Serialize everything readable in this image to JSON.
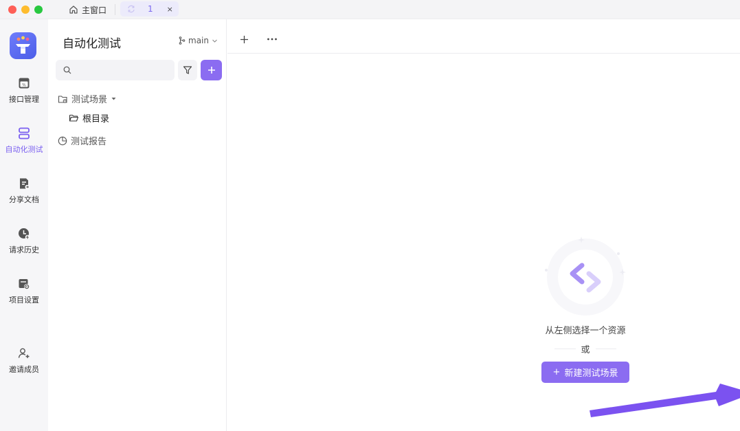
{
  "titlebar": {
    "tabs": [
      {
        "label": "主窗口",
        "icon": "home-icon"
      },
      {
        "label": "1",
        "icon": "sync-icon",
        "close": "×"
      }
    ]
  },
  "rail": {
    "items": [
      {
        "label": "接口管理",
        "icon": "api-icon",
        "active": false
      },
      {
        "label": "自动化测试",
        "icon": "automation-icon",
        "active": true
      },
      {
        "label": "分享文档",
        "icon": "share-doc-icon",
        "active": false
      },
      {
        "label": "请求历史",
        "icon": "history-icon",
        "active": false
      },
      {
        "label": "项目设置",
        "icon": "settings-icon",
        "active": false
      },
      {
        "label": "邀请成员",
        "icon": "invite-user-icon",
        "active": false
      }
    ]
  },
  "panel": {
    "title": "自动化测试",
    "branch": "main",
    "search": {
      "value": "",
      "placeholder": ""
    },
    "tree": {
      "scenes_label": "测试场景",
      "root_label": "根目录",
      "reports_label": "测试报告"
    }
  },
  "main": {
    "empty_text": "从左侧选择一个资源",
    "or_text": "或",
    "new_button": "新建测试场景",
    "new_button_prefix": "+"
  },
  "colors": {
    "accent": "#8b6cf1",
    "active_nav": "#7a5ff0",
    "arrow": "#7b52f0"
  }
}
